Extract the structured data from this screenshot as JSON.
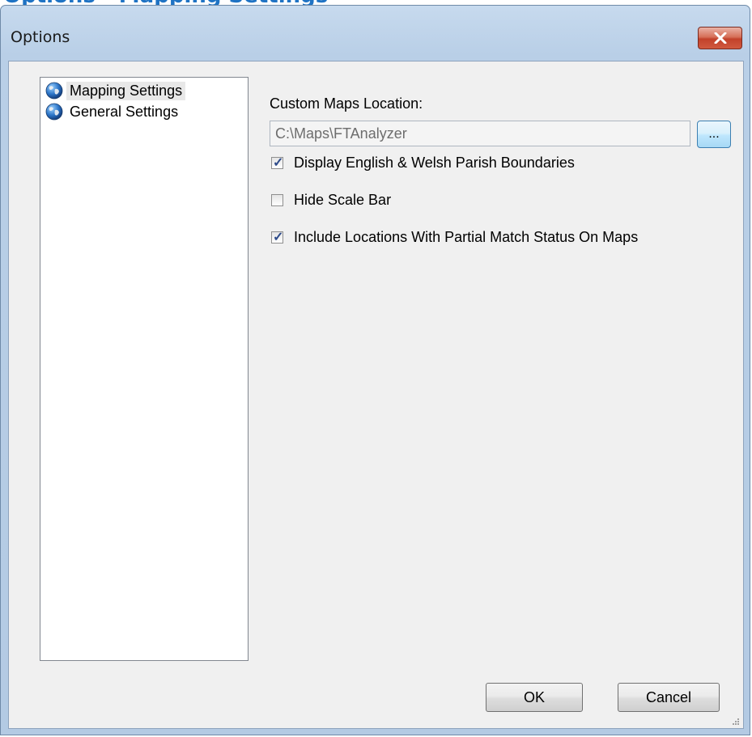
{
  "header_partial": "Options - Mapping Settings",
  "window": {
    "title": "Options",
    "close_glyph": "✕"
  },
  "tree": {
    "items": [
      {
        "label": "Mapping Settings",
        "icon": "globe-icon",
        "selected": true
      },
      {
        "label": "General Settings",
        "icon": "globe-icon",
        "selected": false
      }
    ]
  },
  "mapping": {
    "maps_location_label": "Custom Maps Location:",
    "maps_location_value": "C:\\Maps\\FTAnalyzer",
    "browse_label": "...",
    "checkboxes": [
      {
        "label": "Display English & Welsh Parish Boundaries",
        "checked": true
      },
      {
        "label": "Hide Scale Bar",
        "checked": false
      },
      {
        "label": "Include Locations With Partial Match Status On Maps",
        "checked": true
      }
    ]
  },
  "buttons": {
    "ok": "OK",
    "cancel": "Cancel"
  },
  "colors": {
    "title_bar": "#b9cfe7",
    "close_red": "#c2412a",
    "selection": "#e8e8e8"
  }
}
